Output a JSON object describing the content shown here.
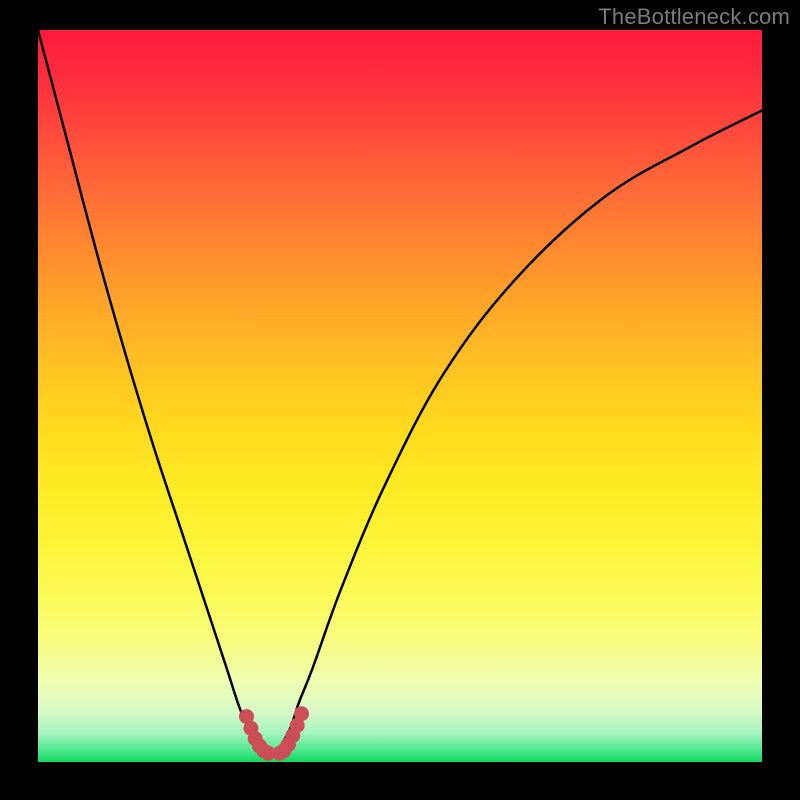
{
  "watermark": "TheBottleneck.com",
  "colors": {
    "frame": "#000000",
    "curve": "#000000",
    "marker": "#cc4f58",
    "gradient_top": "#ff1a3d",
    "gradient_bottom": "#0fd85f"
  },
  "chart_data": {
    "type": "line",
    "title": "",
    "xlabel": "",
    "ylabel": "",
    "xlim": [
      0,
      100
    ],
    "ylim": [
      0,
      100
    ],
    "grid": false,
    "legend": false,
    "series": [
      {
        "name": "bottleneck-curve",
        "color": "#000000",
        "x": [
          0,
          4,
          8,
          12,
          16,
          20,
          23,
          26,
          28,
          30,
          30.5,
          31,
          32,
          33,
          34,
          35,
          36,
          38,
          42,
          48,
          56,
          66,
          78,
          90,
          100
        ],
        "y": [
          100,
          85,
          70,
          56,
          43,
          31,
          22,
          13,
          7,
          3,
          1.5,
          1,
          1,
          1.5,
          3,
          5,
          8,
          13,
          24,
          38,
          53,
          66,
          77,
          84,
          89
        ]
      },
      {
        "name": "optimal-markers",
        "color": "#cc4f58",
        "x": [
          28.8,
          29.4,
          30.0,
          30.6,
          31.2,
          31.8,
          33.4,
          34.0,
          34.6,
          35.2,
          35.8,
          36.4
        ],
        "y": [
          6.2,
          4.6,
          3.2,
          2.2,
          1.5,
          1.2,
          1.2,
          1.6,
          2.4,
          3.6,
          5.0,
          6.6
        ]
      }
    ],
    "annotations": []
  }
}
